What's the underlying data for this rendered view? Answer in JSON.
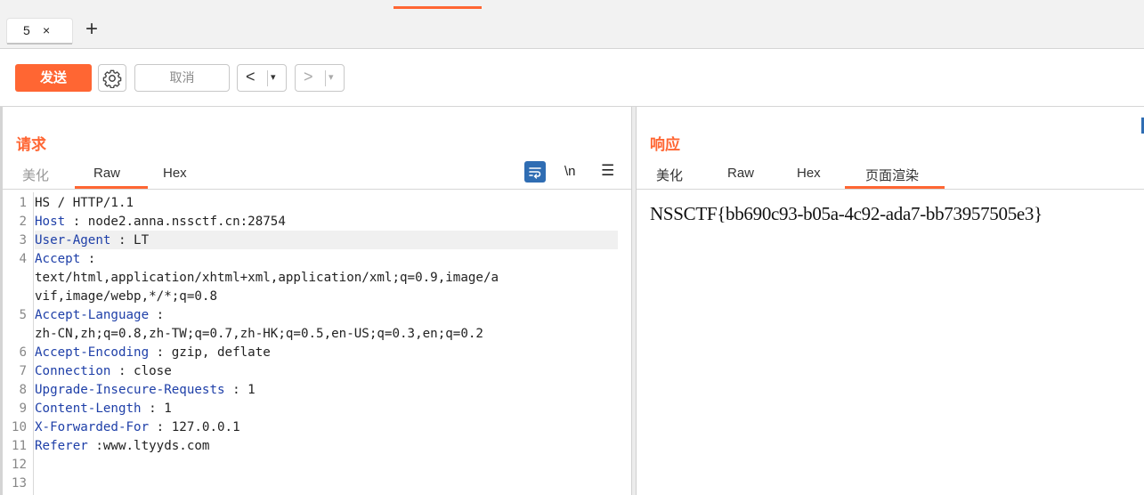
{
  "tabs": [
    {
      "label": "5",
      "close": "×"
    }
  ],
  "add_tab": "+",
  "toolbar": {
    "send": "发送",
    "cancel": "取消",
    "back": "<",
    "forward": ">",
    "dropdown": "▾"
  },
  "request": {
    "title": "请求",
    "view_tabs": [
      "美化",
      "Raw",
      "Hex"
    ],
    "active_view": "Raw",
    "icons": {
      "wrap": "wrap-lines-icon",
      "newline": "\\n",
      "menu": "menu-icon"
    },
    "lines": [
      {
        "num": "1",
        "name": "",
        "sep": "",
        "value": "HS / HTTP/1.1"
      },
      {
        "num": "2",
        "name": "Host",
        "sep": " : ",
        "value": "node2.anna.nssctf.cn:28754"
      },
      {
        "num": "3",
        "name": "User-Agent",
        "sep": " : ",
        "value": "LT"
      },
      {
        "num": "4",
        "name": "Accept",
        "sep": " :",
        "value": ""
      },
      {
        "num": "",
        "name": "",
        "sep": "",
        "value": "text/html,application/xhtml+xml,application/xml;q=0.9,image/a"
      },
      {
        "num": "",
        "name": "",
        "sep": "",
        "value": "vif,image/webp,*/*;q=0.8"
      },
      {
        "num": "5",
        "name": "Accept-Language",
        "sep": " :",
        "value": ""
      },
      {
        "num": "",
        "name": "",
        "sep": "",
        "value": "zh-CN,zh;q=0.8,zh-TW;q=0.7,zh-HK;q=0.5,en-US;q=0.3,en;q=0.2"
      },
      {
        "num": "6",
        "name": "Accept-Encoding",
        "sep": " : ",
        "value": "gzip, deflate"
      },
      {
        "num": "7",
        "name": "Connection",
        "sep": " : ",
        "value": "close"
      },
      {
        "num": "8",
        "name": "Upgrade-Insecure-Requests",
        "sep": " : ",
        "value": "1"
      },
      {
        "num": "9",
        "name": "Content-Length",
        "sep": " : ",
        "value": "1"
      },
      {
        "num": "10",
        "name": "X-Forwarded-For",
        "sep": " : ",
        "value": "127.0.0.1"
      },
      {
        "num": "11",
        "name": "Referer",
        "sep": " :",
        "value": "www.ltyyds.com"
      },
      {
        "num": "12",
        "name": "",
        "sep": "",
        "value": ""
      },
      {
        "num": "13",
        "name": "",
        "sep": "",
        "value": ""
      }
    ]
  },
  "response": {
    "title": "响应",
    "view_tabs": [
      "美化",
      "Raw",
      "Hex",
      "页面渲染"
    ],
    "active_view": "页面渲染",
    "rendered_text": "NSSCTF{bb690c93-b05a-4c92-ada7-bb73957505e3}"
  },
  "colors": {
    "accent": "#ff6633",
    "header_name": "#1e3fa8",
    "wrap_icon_bg": "#2f6db3"
  }
}
